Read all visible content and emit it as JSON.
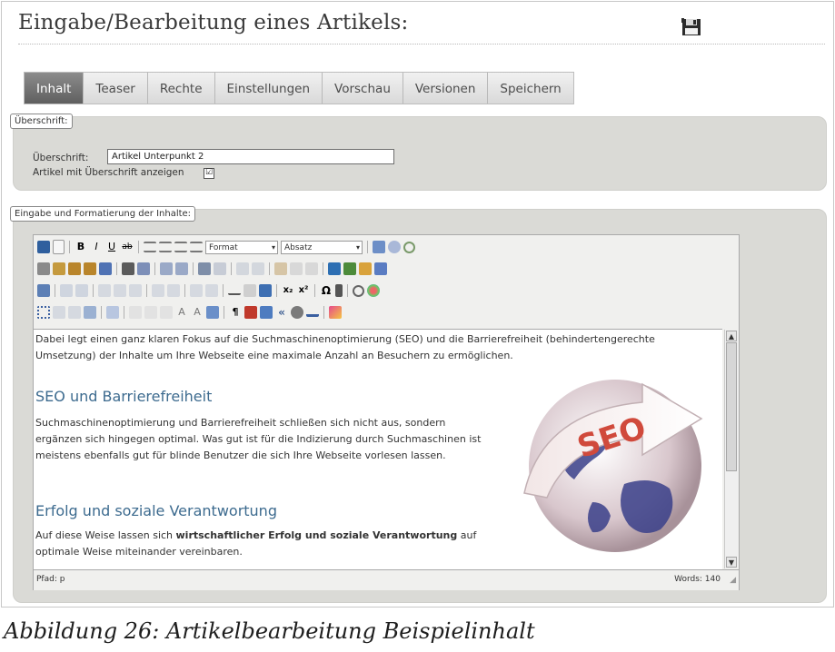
{
  "header": {
    "title": "Eingabe/Bearbeitung eines Artikels:",
    "save_icon": "floppy-disk-icon"
  },
  "tabs": [
    {
      "label": "Inhalt",
      "active": true
    },
    {
      "label": "Teaser"
    },
    {
      "label": "Rechte"
    },
    {
      "label": "Einstellungen"
    },
    {
      "label": "Vorschau"
    },
    {
      "label": "Versionen"
    },
    {
      "label": "Speichern"
    }
  ],
  "heading_panel": {
    "legend": "Überschrift:",
    "heading_label": "Überschrift:",
    "heading_value": "Artikel Unterpunkt 2",
    "show_heading_label": "Artikel mit Überschrift anzeigen",
    "show_heading_checked": true,
    "check_mark": "☑"
  },
  "content_panel": {
    "legend": "Eingabe und Formatierung der Inhalte:"
  },
  "editor": {
    "format_select": "Format",
    "paragraph_select": "Absatz",
    "para1": "Dabei legt einen ganz klaren Fokus auf die Suchmaschinenoptimierung (SEO) und die Barrierefreiheit (behindertengerechte Umsetzung) der Inhalte um Ihre Webseite eine maximale Anzahl an Besuchern zu ermöglichen.",
    "h2_seo": "SEO und Barrierefreiheit",
    "para2": "Suchmaschinenoptimierung und Barrierefreiheit schließen sich nicht aus, sondern ergänzen sich hingegen optimal. Was gut ist für die Indizierung durch Suchmaschinen ist meistens ebenfalls gut für blinde Benutzer die sich Ihre Webseite vorlesen lassen.",
    "h2_erfolg": "Erfolg und soziale Verantwortung",
    "para3a": "Auf diese Weise lassen sich ",
    "para3b": "wirtschaftlicher Erfolg und soziale Verantwortung",
    "para3c": " auf optimale Weise miteinander vereinbaren.",
    "image_text": "SEO",
    "path": "Pfad: p",
    "words": "Words: 140"
  },
  "caption": "Abbildung 26: Artikelbearbeitung Beispielinhalt",
  "colors": {
    "tab_active": "#6f6f6f",
    "panel": "#dadad6",
    "heading_blue": "#3d6b8f",
    "seo_red": "#d04a3c"
  }
}
